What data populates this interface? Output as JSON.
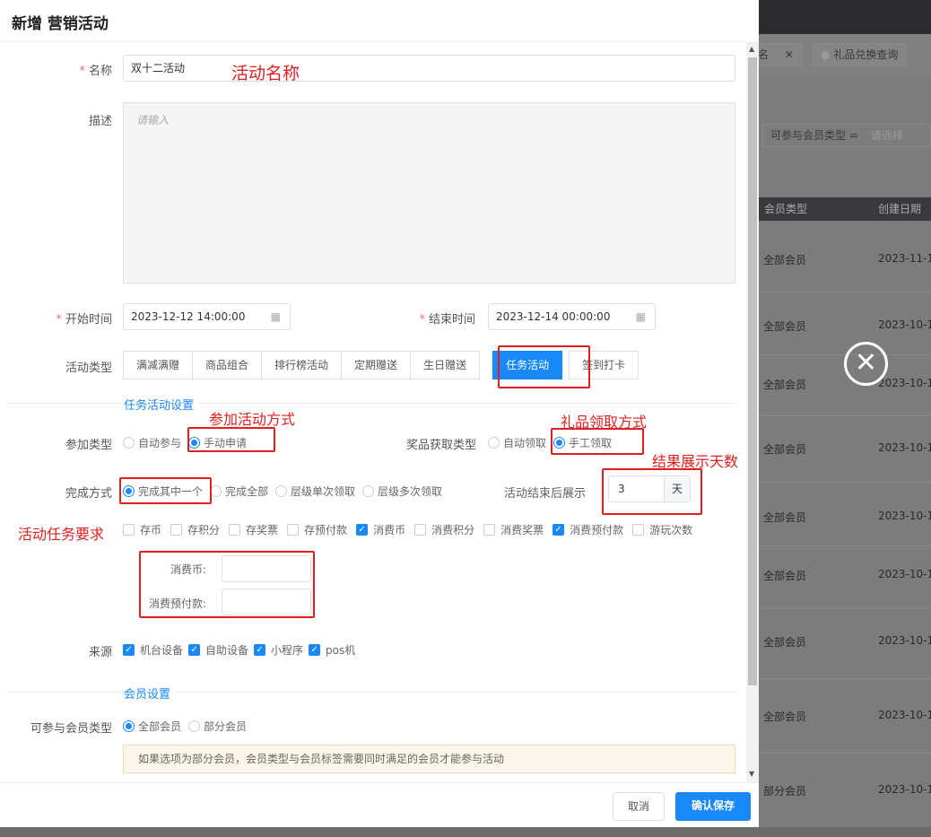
{
  "background": {
    "tabs": [
      "名",
      "礼品兑换查询"
    ],
    "filter_label": "可参与会员类型 =",
    "filter_placeholder": "请选择",
    "columns": [
      "会员类型",
      "创建日期"
    ],
    "rows": [
      {
        "type": "全部会员",
        "date": "2023-11-1"
      },
      {
        "type": "全部会员",
        "date": "2023-10-1"
      },
      {
        "type": "全部会员",
        "date": "2023-10-1"
      },
      {
        "type": "全部会员",
        "date": "2023-10-1"
      },
      {
        "type": "全部会员",
        "date": "2023-10-1"
      },
      {
        "type": "全部会员",
        "date": "2023-10-1"
      },
      {
        "type": "全部会员",
        "date": "2023-10-1"
      },
      {
        "type": "全部会员",
        "date": "2023-10-1"
      },
      {
        "type": "部分会员",
        "date": "2023-10-1"
      }
    ]
  },
  "drawer": {
    "title": "新增 营销活动",
    "name_label": "名称",
    "name_value": "双十二活动",
    "desc_label": "描述",
    "desc_placeholder": "请输入",
    "start_label": "开始时间",
    "start_value": "2023-12-12 14:00:00",
    "end_label": "结束时间",
    "end_value": "2023-12-14 00:00:00",
    "type_label": "活动类型",
    "types": [
      "满减满赠",
      "商品组合",
      "排行榜活动",
      "定期赠送",
      "生日赠送",
      "任务活动",
      "签到打卡"
    ],
    "task_section": "任务活动设置",
    "join_label": "参加类型",
    "join_options": [
      "自动参与",
      "手动申请"
    ],
    "prize_label": "奖品获取类型",
    "prize_options": [
      "自动领取",
      "手工领取"
    ],
    "complete_label": "完成方式",
    "complete_options": [
      "完成其中一个",
      "完成全部",
      "层级单次领取",
      "层级多次领取"
    ],
    "show_label": "活动结束后展示",
    "show_value": "3",
    "show_unit": "天",
    "tasks": [
      {
        "label": "存币",
        "checked": false
      },
      {
        "label": "存积分",
        "checked": false
      },
      {
        "label": "存奖票",
        "checked": false
      },
      {
        "label": "存预付款",
        "checked": false
      },
      {
        "label": "消费币",
        "checked": true
      },
      {
        "label": "消费积分",
        "checked": false
      },
      {
        "label": "消费奖票",
        "checked": false
      },
      {
        "label": "消费预付款",
        "checked": true
      },
      {
        "label": "游玩次数",
        "checked": false
      }
    ],
    "coin_label": "消费币:",
    "prepay_label": "消费预付款:",
    "source_label": "来源",
    "sources": [
      "机台设备",
      "自助设备",
      "小程序",
      "pos机"
    ],
    "member_section": "会员设置",
    "member_label": "可参与会员类型",
    "member_options": [
      "全部会员",
      "部分会员"
    ],
    "notice": "如果选项为部分会员，会员类型与会员标签需要同时满足的会员才能参与活动",
    "cancel": "取消",
    "save": "确认保存"
  },
  "annotations": {
    "name": "活动名称",
    "join": "参加活动方式",
    "prize": "礼品领取方式",
    "days": "结果展示天数",
    "tasks": "活动任务要求"
  },
  "colors": {
    "primary": "#1989fa",
    "annotation": "#e02020"
  }
}
